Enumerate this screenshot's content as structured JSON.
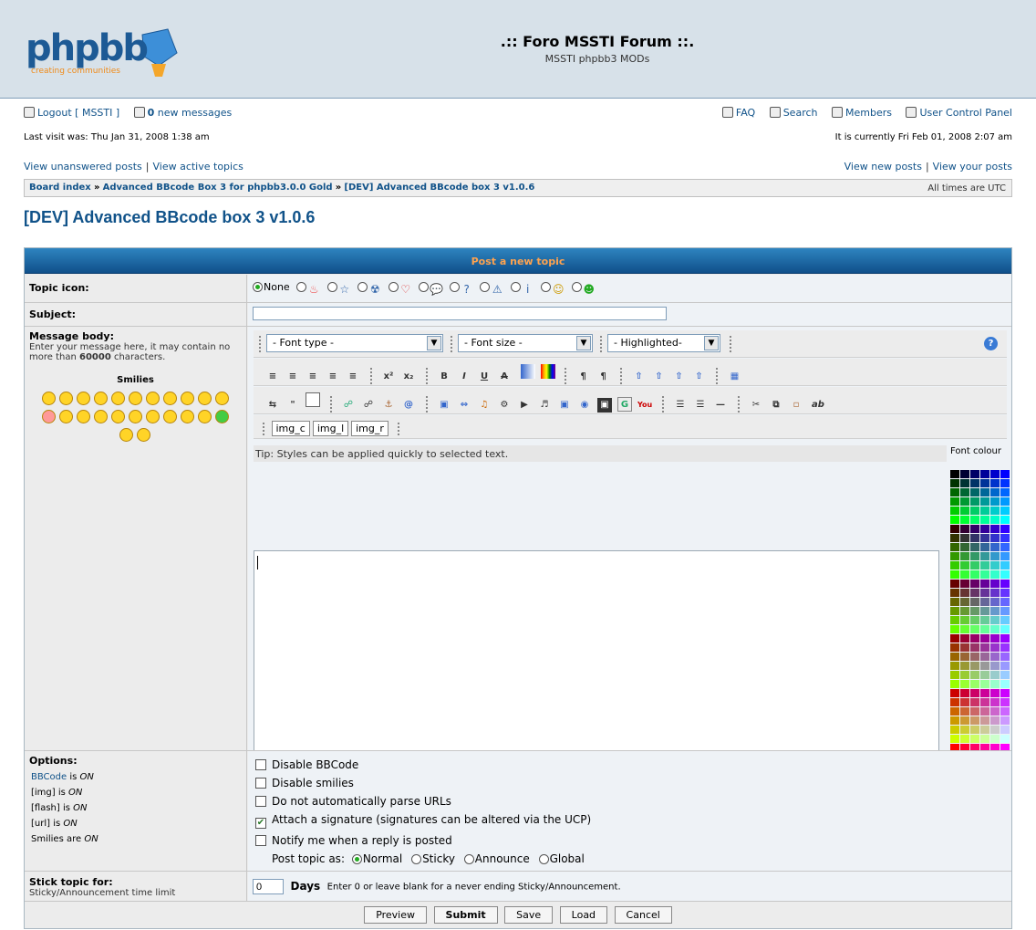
{
  "site": {
    "logo_text": "phpbb",
    "logo_tagline": "creating communities",
    "title": ".:: Foro MSSTI Forum ::.",
    "description": "MSSTI phpbb3 MODs"
  },
  "nav": {
    "logout": "Logout [ MSSTI ]",
    "new_messages_count": "0",
    "new_messages_label": " new messages",
    "faq": "FAQ",
    "search": "Search",
    "members": "Members",
    "ucp": "User Control Panel",
    "last_visit": "Last visit was: Thu Jan 31, 2008 1:38 am",
    "current": "It is currently Fri Feb 01, 2008 2:07 am",
    "unanswered": "View unanswered posts",
    "active": "View active topics",
    "new_posts": "View new posts",
    "your_posts": "View your posts"
  },
  "breadcrumb": {
    "items": [
      "Board index",
      "Advanced BBcode Box 3 for phpbb3.0.0 Gold",
      "[DEV] Advanced BBcode box 3 v1.0.6"
    ],
    "sep": "»",
    "timezone": "All times are UTC"
  },
  "page": {
    "title": "[DEV] Advanced BBcode box 3 v1.0.6",
    "panel_title": "Post a new topic"
  },
  "form": {
    "topic_icon_label": "Topic icon:",
    "none_label": "None",
    "subject_label": "Subject:",
    "subject_value": "",
    "body_label": "Message body:",
    "body_desc_1": "Enter your message here, it may contain no more than ",
    "body_limit": "60000",
    "body_desc_2": " characters.",
    "smilies_label": "Smilies",
    "font_type": "- Font type -",
    "font_size": "- Font size -",
    "highlighted": "- Highlighted-",
    "img_buttons": [
      "img_c",
      "img_l",
      "img_r"
    ],
    "tip": "Tip: Styles can be applied quickly to selected text.",
    "font_colour": "Font colour",
    "options_label": "Options:",
    "bbcode_link": "BBCode",
    "bbcode_status": " is ",
    "on": "ON",
    "img_status": "[img] is ",
    "flash_status": "[flash] is ",
    "url_status": "[url] is ",
    "smilies_status": "Smilies are ",
    "checkboxes": [
      "Disable BBCode",
      "Disable smilies",
      "Do not automatically parse URLs",
      "Attach a signature (signatures can be altered via the UCP)",
      "Notify me when a reply is posted"
    ],
    "post_as": "Post topic as:",
    "post_types": [
      "Normal",
      "Sticky",
      "Announce",
      "Global"
    ],
    "stick_label": "Stick topic for:",
    "stick_desc": "Sticky/Announcement time limit",
    "stick_value": "0",
    "days": "Days",
    "stick_help": "Enter 0 or leave blank for a never ending Sticky/Announcement."
  },
  "buttons": {
    "preview": "Preview",
    "submit": "Submit",
    "save": "Save",
    "load": "Load",
    "cancel": "Cancel"
  },
  "colors": {
    "accent": "#105289",
    "header_bg": "#d7e1e9",
    "panel_title": "#ffa34f"
  }
}
